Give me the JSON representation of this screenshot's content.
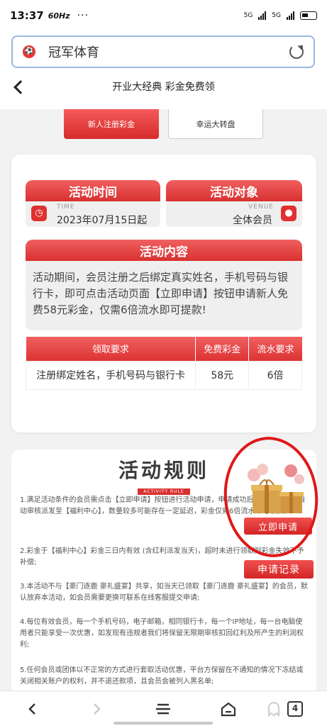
{
  "status": {
    "time": "13:37",
    "refresh": "60Hz",
    "dots": "···",
    "sig1": "5G",
    "sig2": "5G"
  },
  "browser": {
    "url_text": "冠军体育"
  },
  "page": {
    "title": "开业大经典 彩金免费领"
  },
  "tabs": [
    {
      "label": "新人注册彩金"
    },
    {
      "label": "幸运大转盘"
    }
  ],
  "activity": {
    "time_title": "活动时间",
    "time_en": "TIME",
    "time_value": "2023年07月15日起",
    "target_title": "活动对象",
    "target_en": "VENUE",
    "target_value": "全体会员",
    "content_title": "活动内容",
    "content_text": "活动期间，会员注册之后绑定真实姓名，手机号码与银行卡，即可点击活动页面【立即申请】按钮申请新人免费58元彩金，仅需6倍流水即可提款!",
    "table": {
      "headers": [
        "领取要求",
        "免费彩金",
        "流水要求"
      ],
      "row": [
        "注册绑定姓名，手机号码与银行卡",
        "58元",
        "6倍"
      ]
    }
  },
  "rules": {
    "title": "活动规则",
    "subtitle": "ACTIVITY RULE",
    "items": [
      "1.满足活动条件的会员需点击【立即申请】按钮进行活动申请，申请成功后日的48小时内自动审核派发至【福利中心】，数量较多可能存在一定延迟，彩金仅需6倍流水即可取款;",
      "2.彩金于【福利中心】彩金三日内有效 (含红利派发当天)，超时未进行领取则彩金失效不予补偿;",
      "3.本活动不与【豪门逐鹿 豪礼盛宴】共享，如当天已领取【豪门逐鹿 豪礼盛宴】的会员，默认放弃本活动，如会员需要更换可联系在线客服提交申请;",
      "4.每位有效会员，每一个手机号码，电子邮箱，相同银行卡，每一个IP地址，每一台电脑使用者只能享受一次优惠，如发现有违规者我们将保留无限期审核扣回红利及所产生的利润权利;",
      "5.任何会员或团体以不正常的方式进行套取活动优惠，平台方保留在不通知的情况下冻结或关闭相关账户的权利，并不退还款项，且会员会被列入黑名单;"
    ]
  },
  "actions": {
    "apply": "立即申请",
    "records": "申请记录"
  },
  "nav": {
    "tabs_count": "4"
  }
}
